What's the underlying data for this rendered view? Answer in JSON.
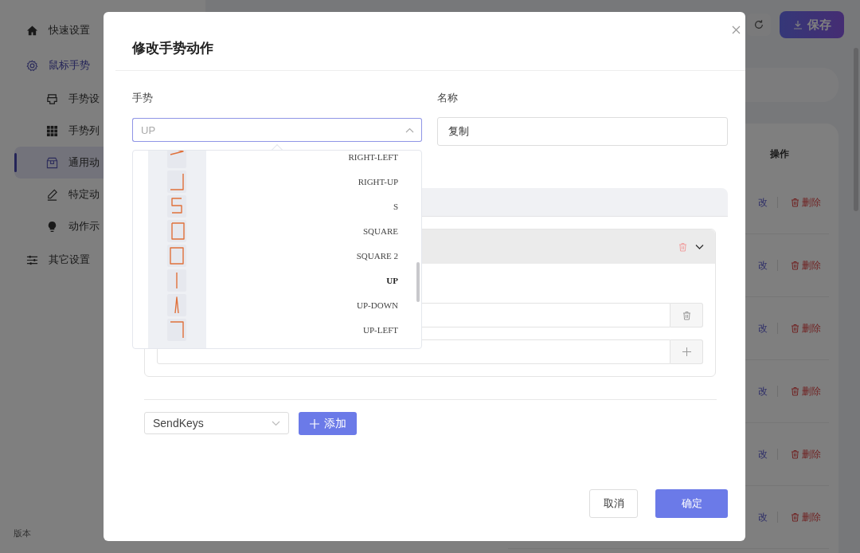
{
  "sidebar": {
    "items": [
      {
        "label": "快速设置"
      },
      {
        "label": "鼠标手势",
        "expanded": true,
        "children": [
          {
            "label": "手势设",
            "selected": false
          },
          {
            "label": "手势列",
            "selected": false
          },
          {
            "label": "通用动",
            "selected": true
          },
          {
            "label": "特定动",
            "selected": false
          },
          {
            "label": "动作示",
            "selected": false
          }
        ]
      },
      {
        "label": "其它设置"
      }
    ],
    "footer": "版本"
  },
  "toolbar": {
    "save_button": "保存"
  },
  "table": {
    "columns": [
      "操作"
    ],
    "rows": [
      {
        "edit": "改",
        "delete": "删除"
      },
      {
        "edit": "改",
        "delete": "删除"
      },
      {
        "edit": "改",
        "delete": "删除"
      },
      {
        "edit": "改",
        "delete": "删除"
      },
      {
        "edit": "改",
        "delete": "删除"
      },
      {
        "edit": "改",
        "delete": "删除"
      }
    ]
  },
  "dialog": {
    "title": "修改手势动作",
    "gesture": {
      "label": "手势",
      "placeholder": "UP",
      "expanded": true,
      "options": [
        {
          "label": "RIGHT-LEFT",
          "selected": false
        },
        {
          "label": "RIGHT-UP",
          "selected": false
        },
        {
          "label": "S",
          "selected": false
        },
        {
          "label": "SQUARE",
          "selected": false
        },
        {
          "label": "SQUARE 2",
          "selected": false
        },
        {
          "label": "UP",
          "selected": true
        },
        {
          "label": "UP-DOWN",
          "selected": false
        },
        {
          "label": "UP-LEFT",
          "selected": false
        }
      ]
    },
    "name": {
      "label": "名称",
      "value": "复制"
    },
    "action": {
      "expanded": true
    },
    "action_select": {
      "value": "SendKeys"
    },
    "add_button": "添加",
    "cancel_button": "取消",
    "ok_button": "确定"
  }
}
